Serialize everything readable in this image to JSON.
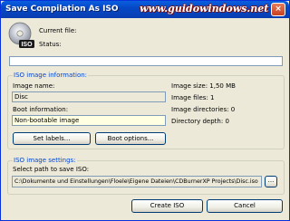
{
  "window": {
    "title": "Save Compilation As ISO",
    "watermark": "www.guidowindows.net",
    "close_glyph": "×"
  },
  "header": {
    "current_file_label": "Current file:",
    "status_label": "Status:",
    "icon": "disc-iso-icon",
    "iso_badge": "ISO"
  },
  "iso_info": {
    "group_title": "ISO image information:",
    "image_name_label": "Image name:",
    "image_name_value": "Disc",
    "boot_info_label": "Boot information:",
    "boot_info_value": "Non-bootable image",
    "image_size": "Image size: 1,50 MB",
    "image_files": "Image files: 1",
    "image_directories": "Image directories: 0",
    "directory_depth": "Directory depth: 0",
    "set_labels_button": "Set labels...",
    "boot_options_button": "Boot options..."
  },
  "iso_settings": {
    "group_title": "ISO image settings:",
    "path_label": "Select path to save ISO:",
    "path_value": "C:\\Dokumente und Einstellungen\\Floele\\Eigene Dateien\\CDBurnerXP Projects\\Disc.iso",
    "browse_button": "..."
  },
  "footer": {
    "create_button": "Create ISO",
    "cancel_button": "Cancel"
  },
  "colors": {
    "title_bar": "#0a5fe0",
    "group_title": "#0046d5",
    "window_bg": "#ece9d8"
  }
}
